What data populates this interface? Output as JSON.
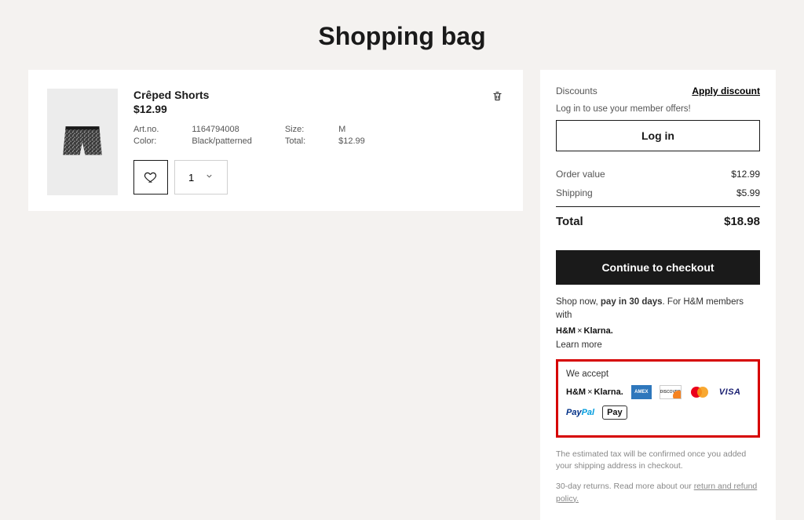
{
  "page_title": "Shopping bag",
  "item": {
    "title": "Crêped Shorts",
    "price": "$12.99",
    "meta_labels": {
      "artno": "Art.no.",
      "color": "Color:",
      "size": "Size:",
      "total": "Total:"
    },
    "artno": "1164794008",
    "color": "Black/patterned",
    "size": "M",
    "total": "$12.99",
    "qty": "1"
  },
  "summary": {
    "discounts_label": "Discounts",
    "apply_discount_label": "Apply discount",
    "login_msg": "Log in to use your member offers!",
    "login_button": "Log in",
    "order_value_label": "Order value",
    "order_value": "$12.99",
    "shipping_label": "Shipping",
    "shipping_value": "$5.99",
    "total_label": "Total",
    "total_value": "$18.98",
    "checkout_button": "Continue to checkout",
    "note_pre": "Shop now, ",
    "note_bold": "pay in 30 days",
    "note_post": ". For H&M members with",
    "brand_hm": "H&M",
    "brand_x": "×",
    "brand_klarna": "Klarna.",
    "learn_more": "Learn more",
    "we_accept": "We accept",
    "pm_amex": "AMEX",
    "pm_disc": "DISCOVER",
    "pm_visa": "VISA",
    "pm_paypal_1": "Pay",
    "pm_paypal_2": "Pal",
    "pm_applepay": "Pay",
    "tax_note": "The estimated tax will be confirmed once you added your shipping address in checkout.",
    "returns_pre": "30-day returns. Read more about our ",
    "returns_link": "return and refund policy."
  }
}
